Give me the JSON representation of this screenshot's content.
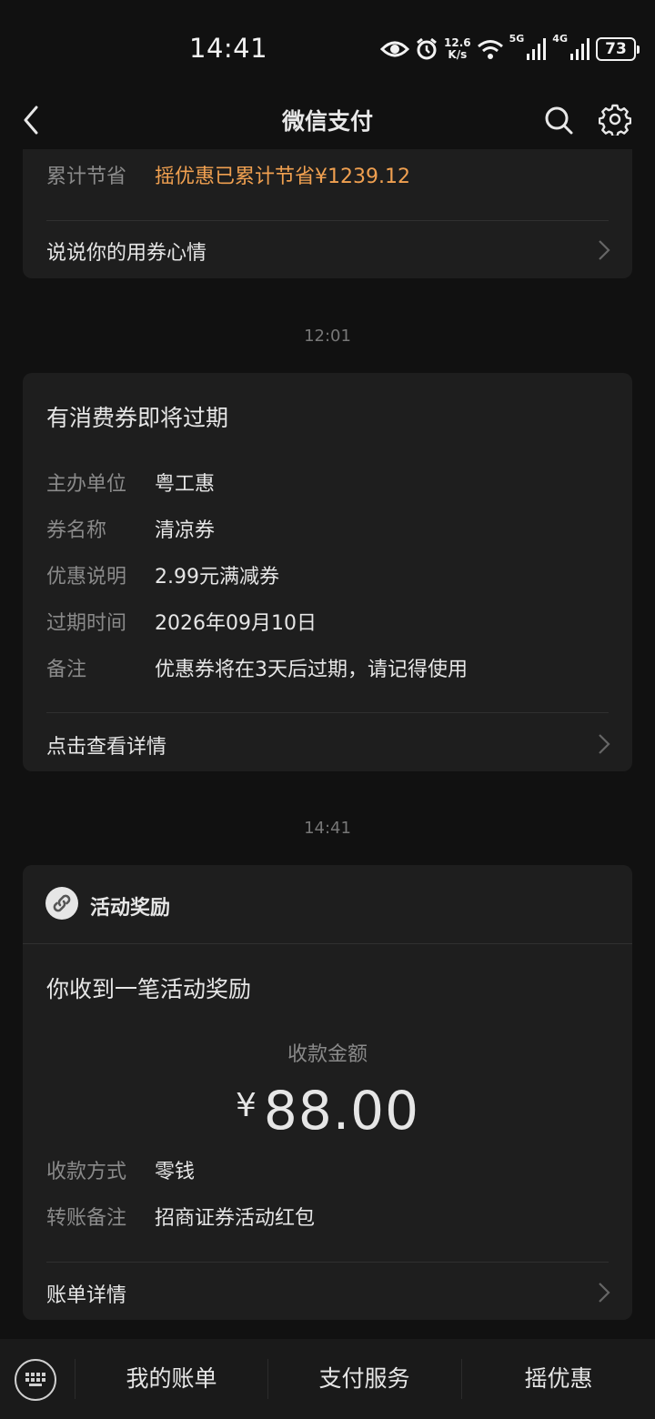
{
  "status_bar": {
    "time": "14:41",
    "net_speed_value": "12.6",
    "net_speed_unit": "K/s",
    "sig1_label": "5G",
    "sig2_label": "4G",
    "battery": "73"
  },
  "nav": {
    "title": "微信支付"
  },
  "card1": {
    "label": "累计节省",
    "value": "摇优惠已累计节省¥1239.12",
    "link": "说说你的用券心情",
    "value_color": "#f0a050"
  },
  "time_1": "12:01",
  "card2": {
    "title": "有消费券即将过期",
    "rows": [
      {
        "label": "主办单位",
        "value": "粤工惠"
      },
      {
        "label": "券名称",
        "value": "清凉券"
      },
      {
        "label": "优惠说明",
        "value": "2.99元满减券"
      },
      {
        "label": "过期时间",
        "value": "2026年09月10日"
      },
      {
        "label": "备注",
        "value": "优惠券将在3天后过期，请记得使用"
      }
    ],
    "link": "点击查看详情"
  },
  "time_2": "14:41",
  "card3": {
    "header": "活动奖励",
    "title": "你收到一笔活动奖励",
    "amount_label": "收款金额",
    "currency": "¥",
    "amount": "88.00",
    "rows": [
      {
        "label": "收款方式",
        "value": "零钱"
      },
      {
        "label": "转账备注",
        "value": "招商证券活动红包"
      }
    ],
    "link": "账单详情"
  },
  "bottom_bar": {
    "tabs": [
      "我的账单",
      "支付服务",
      "摇优惠"
    ]
  }
}
